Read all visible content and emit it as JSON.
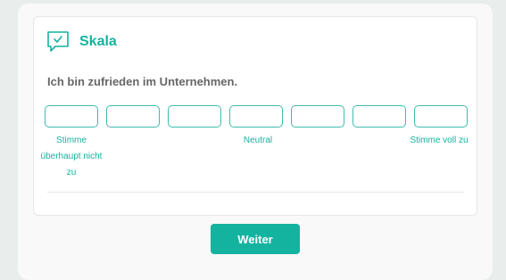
{
  "card": {
    "title": "Skala",
    "icon": "chat-check-icon",
    "question": "Ich bin zufrieden im Unternehmen."
  },
  "scale": {
    "option_count": 7,
    "label_left": "Stimme überhaupt nicht zu",
    "label_middle": "Neutral",
    "label_right": "Stimme voll zu"
  },
  "actions": {
    "next_label": "Weiter"
  },
  "colors": {
    "accent": "#14b3a0",
    "text_muted": "#666666",
    "background": "#e9eeec"
  }
}
